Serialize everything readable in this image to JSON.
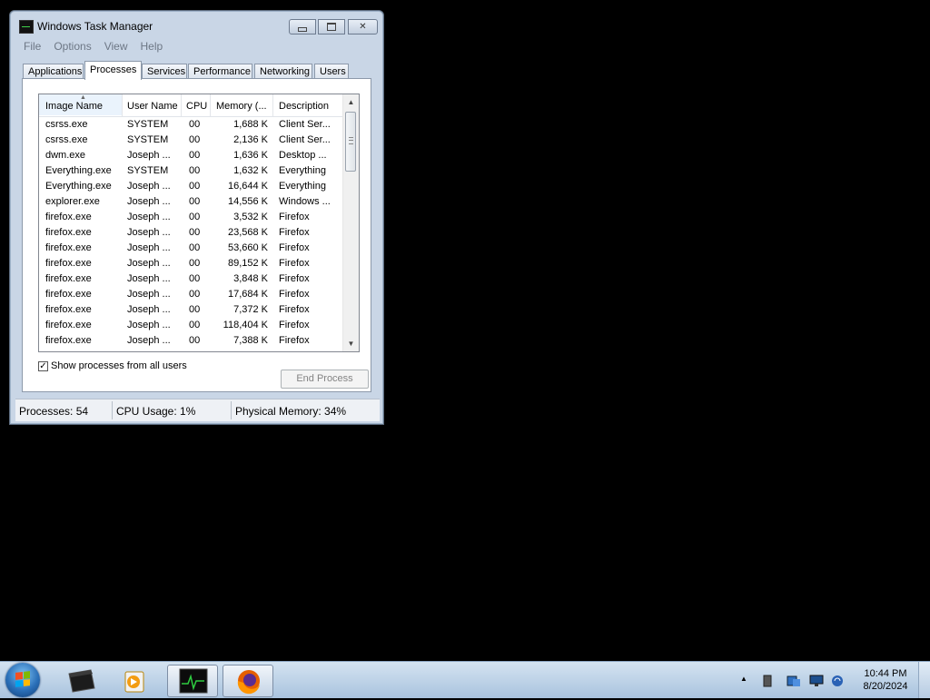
{
  "window": {
    "title": "Windows Task Manager",
    "menu": [
      "File",
      "Options",
      "View",
      "Help"
    ],
    "tabs": [
      "Applications",
      "Processes",
      "Services",
      "Performance",
      "Networking",
      "Users"
    ],
    "active_tab": "Processes"
  },
  "table": {
    "headers": {
      "name": "Image Name",
      "user": "User Name",
      "cpu": "CPU",
      "memory": "Memory (...",
      "description": "Description"
    },
    "rows": [
      {
        "name": "csrss.exe",
        "user": "SYSTEM",
        "cpu": "00",
        "memory": "1,688 K",
        "description": "Client Ser..."
      },
      {
        "name": "csrss.exe",
        "user": "SYSTEM",
        "cpu": "00",
        "memory": "2,136 K",
        "description": "Client Ser..."
      },
      {
        "name": "dwm.exe",
        "user": "Joseph ...",
        "cpu": "00",
        "memory": "1,636 K",
        "description": "Desktop ..."
      },
      {
        "name": "Everything.exe",
        "user": "SYSTEM",
        "cpu": "00",
        "memory": "1,632 K",
        "description": "Everything"
      },
      {
        "name": "Everything.exe",
        "user": "Joseph ...",
        "cpu": "00",
        "memory": "16,644 K",
        "description": "Everything"
      },
      {
        "name": "explorer.exe",
        "user": "Joseph ...",
        "cpu": "00",
        "memory": "14,556 K",
        "description": "Windows ..."
      },
      {
        "name": "firefox.exe",
        "user": "Joseph ...",
        "cpu": "00",
        "memory": "3,532 K",
        "description": "Firefox"
      },
      {
        "name": "firefox.exe",
        "user": "Joseph ...",
        "cpu": "00",
        "memory": "23,568 K",
        "description": "Firefox"
      },
      {
        "name": "firefox.exe",
        "user": "Joseph ...",
        "cpu": "00",
        "memory": "53,660 K",
        "description": "Firefox"
      },
      {
        "name": "firefox.exe",
        "user": "Joseph ...",
        "cpu": "00",
        "memory": "89,152 K",
        "description": "Firefox"
      },
      {
        "name": "firefox.exe",
        "user": "Joseph ...",
        "cpu": "00",
        "memory": "3,848 K",
        "description": "Firefox"
      },
      {
        "name": "firefox.exe",
        "user": "Joseph ...",
        "cpu": "00",
        "memory": "17,684 K",
        "description": "Firefox"
      },
      {
        "name": "firefox.exe",
        "user": "Joseph ...",
        "cpu": "00",
        "memory": "7,372 K",
        "description": "Firefox"
      },
      {
        "name": "firefox.exe",
        "user": "Joseph ...",
        "cpu": "00",
        "memory": "118,404 K",
        "description": "Firefox"
      },
      {
        "name": "firefox.exe",
        "user": "Joseph ...",
        "cpu": "00",
        "memory": "7,388 K",
        "description": "Firefox"
      }
    ]
  },
  "show_all_processes": {
    "label": "Show processes from all users",
    "checked": true
  },
  "end_process_label": "End Process",
  "status": {
    "processes": "Processes: 54",
    "cpu": "CPU Usage: 1%",
    "memory": "Physical Memory: 34%"
  },
  "taskbar": {
    "icons": [
      "start-orb",
      "black-box-app-icon",
      "media-player-icon",
      "task-manager-icon",
      "firefox-icon"
    ],
    "tray_icons": [
      "show-hidden-icons-arrow",
      "tray-device-icon",
      "tray-network-drive-icon",
      "tray-monitor-icon",
      "tray-volume-icon"
    ],
    "clock_time": "10:44 PM",
    "clock_date": "8/20/2024"
  },
  "colors": {
    "window_frame": "#c9d6e6",
    "desktop": "#000000",
    "taskbar": "#b9d0e8"
  }
}
